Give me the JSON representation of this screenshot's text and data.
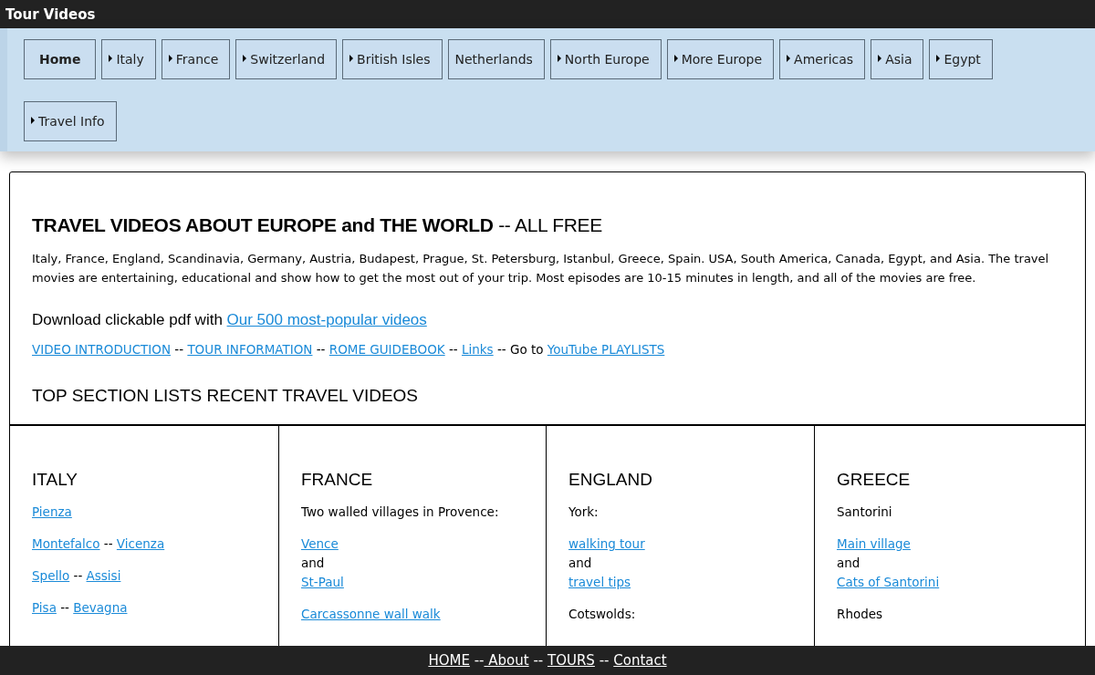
{
  "top_bar": {
    "title": "Tour Videos"
  },
  "nav": [
    {
      "label": "Home",
      "arrow": false,
      "selected": true
    },
    {
      "label": "Italy",
      "arrow": true,
      "selected": false
    },
    {
      "label": "France",
      "arrow": true,
      "selected": false
    },
    {
      "label": "Switzerland",
      "arrow": true,
      "selected": false
    },
    {
      "label": "British Isles",
      "arrow": true,
      "selected": false
    },
    {
      "label": "Netherlands",
      "arrow": false,
      "selected": false
    },
    {
      "label": "North Europe",
      "arrow": true,
      "selected": false
    },
    {
      "label": "More Europe",
      "arrow": true,
      "selected": false
    },
    {
      "label": "Americas",
      "arrow": true,
      "selected": false
    },
    {
      "label": "Asia",
      "arrow": true,
      "selected": false
    },
    {
      "label": "Egypt",
      "arrow": true,
      "selected": false
    },
    {
      "label": "Travel Info",
      "arrow": true,
      "selected": false
    }
  ],
  "intro": {
    "heading": "**TRAVEL VIDEOS ABOUT EUROPE and THE WORLD** -- ALL FREE",
    "description": "Italy, France, England, Scandinavia, Germany, Austria, Budapest, Prague, St. Petersburg, Istanbul, Greece, Spain. USA, South America, Canada, Egypt, and Asia. The travel movies are entertaining, educational and show how to get the most out of your trip. Most episodes are 10-15 minutes in length, and all of the movies are free.",
    "download": [
      {
        "kind": "text",
        "text": "Download clickable pdf with "
      },
      {
        "kind": "link",
        "text": "Our 500 most-popular videos"
      }
    ],
    "links": [
      {
        "kind": "link",
        "text": "VIDEO INTRODUCTION"
      },
      {
        "kind": "text",
        "text": " -- "
      },
      {
        "kind": "link",
        "text": "TOUR INFORMATION"
      },
      {
        "kind": "text",
        "text": " -- "
      },
      {
        "kind": "link",
        "text": "ROME GUIDEBOOK"
      },
      {
        "kind": "text",
        "text": " -- "
      },
      {
        "kind": "link",
        "text": "Links"
      },
      {
        "kind": "text",
        "text": " -- Go to "
      },
      {
        "kind": "link",
        "text": "YouTube PLAYLISTS"
      }
    ],
    "section_heading": "TOP SECTION LISTS RECENT TRAVEL VIDEOS"
  },
  "columns": [
    {
      "heading": "ITALY",
      "paragraphs": [
        [
          [
            {
              "kind": "link",
              "text": "Pienza"
            }
          ]
        ],
        [
          [
            {
              "kind": "link",
              "text": "Montefalco"
            },
            {
              "kind": "text",
              "text": " -- "
            },
            {
              "kind": "link",
              "text": "Vicenza"
            }
          ]
        ],
        [
          [
            {
              "kind": "link",
              "text": "Spello"
            },
            {
              "kind": "text",
              "text": " -- "
            },
            {
              "kind": "link",
              "text": "Assisi"
            }
          ]
        ],
        [
          [
            {
              "kind": "link",
              "text": "Pisa"
            },
            {
              "kind": "text",
              "text": " -- "
            },
            {
              "kind": "link",
              "text": "Bevagna"
            }
          ]
        ]
      ]
    },
    {
      "heading": "FRANCE",
      "paragraphs": [
        [
          [
            {
              "kind": "text",
              "text": "Two walled villages in Provence:"
            }
          ]
        ],
        [
          [
            {
              "kind": "link",
              "text": "Vence"
            }
          ],
          [
            {
              "kind": "text",
              "text": "and"
            }
          ],
          [
            {
              "kind": "link",
              "text": "St-Paul"
            }
          ]
        ],
        [
          [
            {
              "kind": "link",
              "text": "Carcassonne wall walk"
            }
          ]
        ]
      ]
    },
    {
      "heading": "ENGLAND",
      "paragraphs": [
        [
          [
            {
              "kind": "text",
              "text": "York:"
            }
          ]
        ],
        [
          [
            {
              "kind": "link",
              "text": "walking tour"
            }
          ],
          [
            {
              "kind": "text",
              "text": "and"
            }
          ],
          [
            {
              "kind": "link",
              "text": "travel tips"
            }
          ]
        ],
        [
          [
            {
              "kind": "text",
              "text": "Cotswolds:"
            }
          ]
        ]
      ]
    },
    {
      "heading": "GREECE",
      "paragraphs": [
        [
          [
            {
              "kind": "text",
              "text": "Santorini"
            }
          ]
        ],
        [
          [
            {
              "kind": "link",
              "text": "Main village"
            }
          ],
          [
            {
              "kind": "text",
              "text": "and"
            }
          ],
          [
            {
              "kind": "link",
              "text": "Cats of Santorini"
            }
          ]
        ],
        [
          [
            {
              "kind": "text",
              "text": "Rhodes"
            }
          ]
        ]
      ]
    }
  ],
  "footer": [
    {
      "kind": "link",
      "text": "HOME"
    },
    {
      "kind": "text",
      "text": " --"
    },
    {
      "kind": "link",
      "text": " About"
    },
    {
      "kind": "text",
      "text": " -- "
    },
    {
      "kind": "link",
      "text": "TOURS"
    },
    {
      "kind": "text",
      "text": " -- "
    },
    {
      "kind": "link",
      "text": "Contact"
    }
  ]
}
